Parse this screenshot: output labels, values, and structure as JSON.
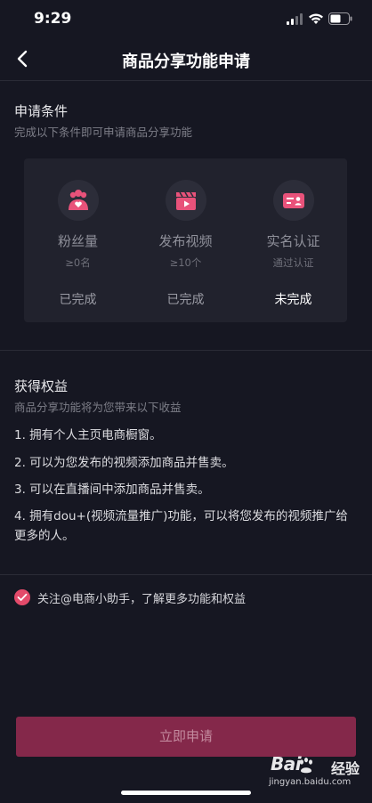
{
  "status_bar": {
    "time": "9:29"
  },
  "nav": {
    "title": "商品分享功能申请"
  },
  "conditions": {
    "title": "申请条件",
    "subtitle": "完成以下条件即可申请商品分享功能",
    "items": [
      {
        "name": "粉丝量",
        "requirement": "≥0名",
        "status": "已完成",
        "icon": "fans-icon"
      },
      {
        "name": "发布视频",
        "requirement": "≥10个",
        "status": "已完成",
        "icon": "video-clapper-icon"
      },
      {
        "name": "实名认证",
        "requirement": "通过认证",
        "status": "未完成",
        "icon": "id-card-icon"
      }
    ]
  },
  "benefits": {
    "title": "获得权益",
    "subtitle": "商品分享功能将为您带来以下收益",
    "items": [
      "1. 拥有个人主页电商橱窗。",
      "2. 可以为您发布的视频添加商品并售卖。",
      "3. 可以在直播间中添加商品并售卖。",
      "4. 拥有dou+(视频流量推广)功能，可以将您发布的视频推广给更多的人。"
    ]
  },
  "follow": {
    "label": "关注@电商小助手，了解更多功能和权益",
    "checked": true
  },
  "apply_button": {
    "label": "立即申请"
  },
  "watermark": {
    "logo_text": "Bai",
    "brand_cn": "经验",
    "url": "jingyan.baidu.com"
  },
  "colors": {
    "background": "#161722",
    "card": "#21222d",
    "accent": "#e34a6a",
    "button": "#84284a"
  }
}
